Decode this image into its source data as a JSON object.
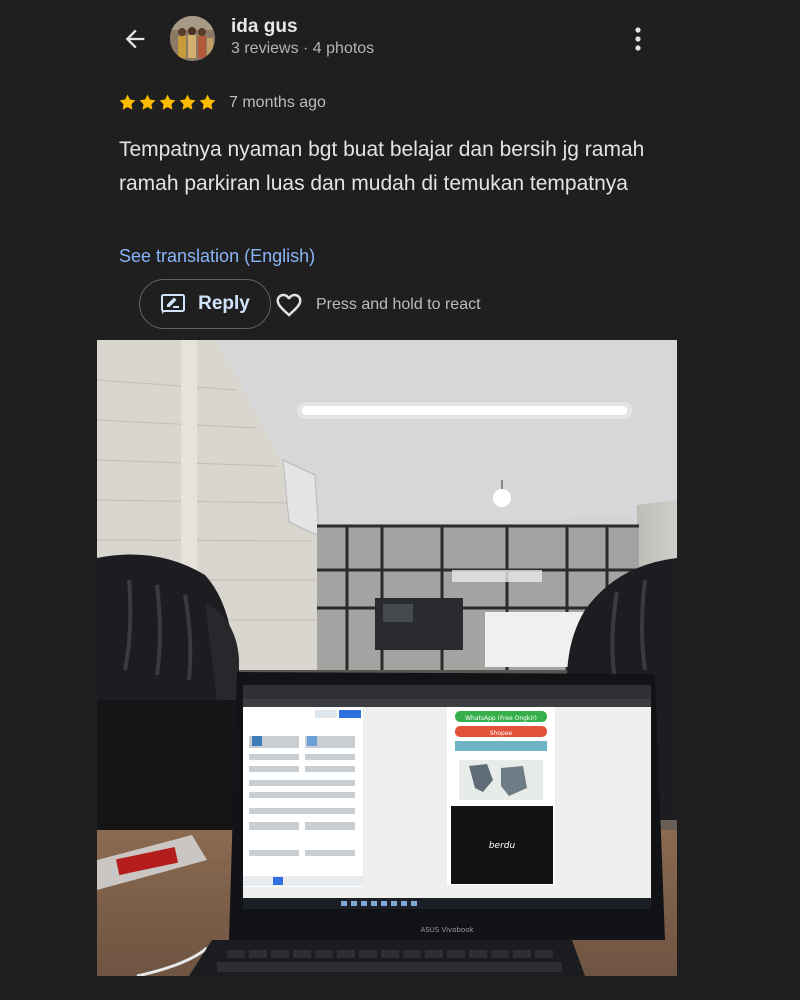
{
  "header": {
    "back_icon": "arrow-left-icon",
    "user_name": "ida gus",
    "user_meta": "3 reviews · 4 photos",
    "more_icon": "more-vertical-icon"
  },
  "review": {
    "rating": 5,
    "rating_max": 5,
    "star_color": "#fbbc04",
    "time_ago": "7 months ago",
    "text": "Tempatnya nyaman bgt buat belajar dan bersih jg ramah ramah parkiran luas dan mudah di temukan tempatnya",
    "translate_label": "See translation (English)"
  },
  "actions": {
    "reply_label": "Reply",
    "reply_icon": "reply-icon",
    "heart_icon": "heart-icon",
    "react_hint": "Press and hold to react"
  },
  "photo": {
    "laptop_brand": "ASUS Vivobook",
    "screen_button_1": "WhatsApp (Free Ongkir)",
    "screen_button_2": "Shopee",
    "screen_brand": "berdu"
  },
  "colors": {
    "background": "#1f1f1f",
    "link": "#8ab4f8",
    "star": "#fbbc04"
  }
}
